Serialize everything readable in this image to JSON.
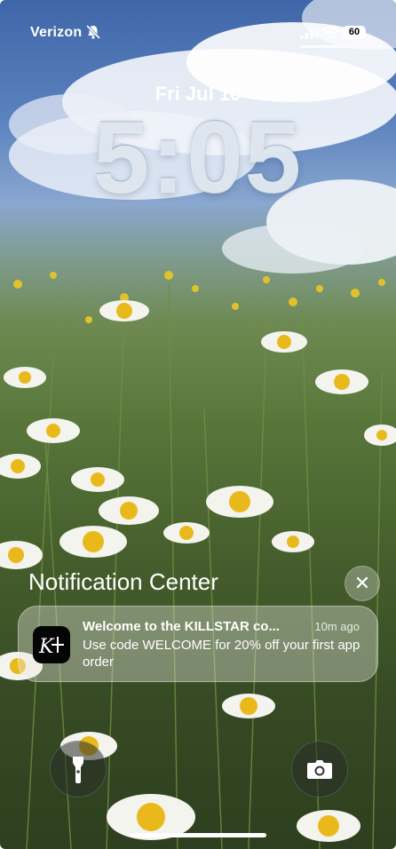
{
  "status_bar": {
    "carrier": "Verizon",
    "battery": "60",
    "icons": [
      "bell-slash-icon",
      "signal-icon",
      "wifi-icon",
      "battery-icon"
    ]
  },
  "lock_screen": {
    "date": "Fri Jul 10",
    "time": "5:05"
  },
  "notification_center": {
    "title": "Notification Center",
    "close_icon": "✕"
  },
  "notification": {
    "app_icon_text": "K",
    "title": "Welcome to the KILLSTAR co...",
    "time_ago": "10m ago",
    "body": "Use code WELCOME for 20% off your first app order"
  },
  "quick_actions": {
    "left": "flashlight-icon",
    "right": "camera-icon"
  }
}
